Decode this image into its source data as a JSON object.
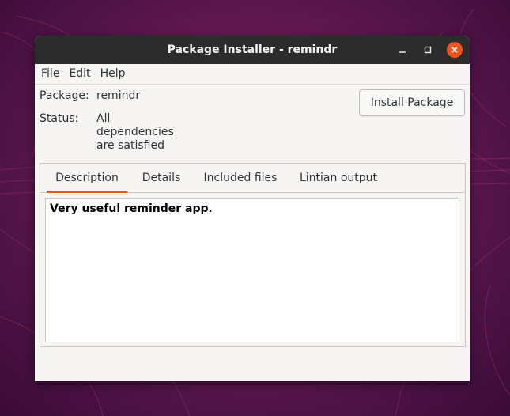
{
  "window": {
    "title": "Package Installer - remindr"
  },
  "menubar": {
    "items": [
      "File",
      "Edit",
      "Help"
    ]
  },
  "info": {
    "package_label": "Package:",
    "package_value": "remindr",
    "status_label": "Status:",
    "status_lines": [
      "All",
      "dependencies",
      "are satisfied"
    ]
  },
  "actions": {
    "install_label": "Install Package"
  },
  "tabs": [
    {
      "label": "Description",
      "active": true
    },
    {
      "label": "Details",
      "active": false
    },
    {
      "label": "Included files",
      "active": false
    },
    {
      "label": "Lintian output",
      "active": false
    }
  ],
  "description": {
    "text": "Very useful reminder app."
  },
  "colors": {
    "accent": "#e95420",
    "titlebar": "#2c2c2c",
    "window_bg": "#f6f5f4"
  }
}
